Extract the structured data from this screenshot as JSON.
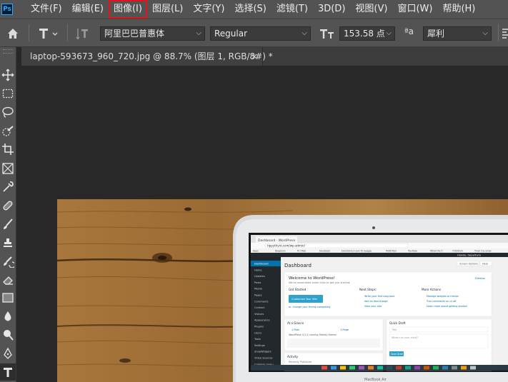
{
  "app": {
    "logo_text": "Ps"
  },
  "menu": {
    "items": [
      {
        "label": "文件(F)",
        "name": "menu-file"
      },
      {
        "label": "编辑(E)",
        "name": "menu-edit"
      },
      {
        "label": "图像(I)",
        "name": "menu-image",
        "highlighted": true
      },
      {
        "label": "图层(L)",
        "name": "menu-layer"
      },
      {
        "label": "文字(Y)",
        "name": "menu-type"
      },
      {
        "label": "选择(S)",
        "name": "menu-select"
      },
      {
        "label": "滤镜(T)",
        "name": "menu-filter"
      },
      {
        "label": "3D(D)",
        "name": "menu-3d"
      },
      {
        "label": "视图(V)",
        "name": "menu-view"
      },
      {
        "label": "窗口(W)",
        "name": "menu-window"
      },
      {
        "label": "帮助(H)",
        "name": "menu-help"
      }
    ],
    "highlight_color": "#e0141c"
  },
  "options": {
    "font_family": "阿里巴巴普惠体",
    "font_style": "Regular",
    "font_size": "153.58 点",
    "aa_icon": "ªa",
    "antialias": "犀利"
  },
  "document": {
    "tab_title": "laptop-593673_960_720.jpg @ 88.7% (图层 1, RGB/8#) *",
    "close_glyph": "×"
  },
  "tools": [
    "move-tool-icon",
    "marquee-tool-icon",
    "lasso-tool-icon",
    "quick-select-tool-icon",
    "crop-tool-icon",
    "frame-tool-icon",
    "eyedropper-tool-icon",
    "healing-brush-tool-icon",
    "brush-tool-icon",
    "clone-stamp-tool-icon",
    "history-brush-tool-icon",
    "eraser-tool-icon",
    "gradient-tool-icon",
    "blur-tool-icon",
    "dodge-tool-icon",
    "pen-tool-icon",
    "type-tool-icon"
  ],
  "canvas": {
    "screen": {
      "browser_tab": "Dashboard · WordPress",
      "url": "tippythyro.com/wp-admin/",
      "bookmarks": [
        "Apps",
        "Bloglovin",
        "M I Mail",
        "Facebook",
        "Electronics Cars Yu",
        "Google",
        "MSN Mail",
        "YouTube",
        "What the F",
        "TODOism",
        "Track my order"
      ],
      "sidebar": [
        "Dashboard",
        "Home",
        "Updates",
        "Posts",
        "Media",
        "Pages",
        "Comments",
        "Contact",
        "Visitors",
        "Appearance",
        "Plugins",
        "Users",
        "Tools",
        "Settings",
        "SnapWidgets",
        "Video Sources",
        "Collapse menu"
      ],
      "heading": "Dashboard",
      "welcome_title": "Welcome to WordPress!",
      "welcome_sub": "We've assembled some links to get you started:",
      "get_started": "Get Started",
      "customize_button": "Customize Your Site",
      "change_theme": "or, change your theme completely",
      "next_steps": "Next Steps",
      "next_items": [
        "Write your first blog post",
        "Add an About page",
        "View your site"
      ],
      "more_actions": "More Actions",
      "more_items": [
        "Manage widgets or menus",
        "Turn comments on or off",
        "Learn more about getting started"
      ],
      "at_a_glance": "At a Glance",
      "glance_items": [
        "1 Post",
        "1 Page"
      ],
      "glance_text": "WordPress 4.2.2 running Twenty theme.",
      "quick_draft": "Quick Draft",
      "title_placeholder": "Title",
      "body_placeholder": "What's on your mind?",
      "save_draft": "Save Draft",
      "activity": "Activity",
      "recently": "Recently Published",
      "screen_options": "Screen Options",
      "help_label": "Help",
      "dismiss": "Dismiss",
      "howdy": "Howdy, tippythyro",
      "macbook_label": "MacBook Air"
    }
  }
}
